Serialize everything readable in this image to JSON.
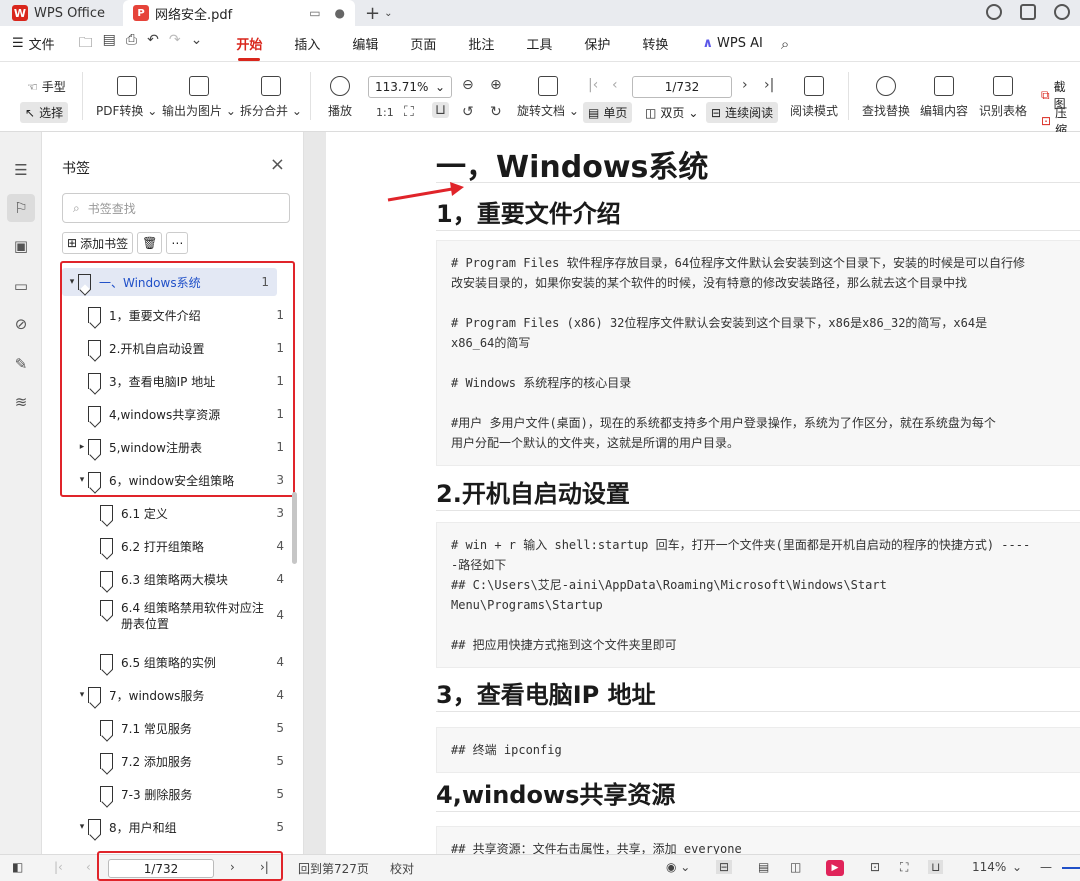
{
  "titlebar": {
    "app_name": "WPS Office",
    "tab_title": "网络安全.pdf"
  },
  "menubar": {
    "file_label": "文件",
    "tabs": [
      "开始",
      "插入",
      "编辑",
      "页面",
      "批注",
      "工具",
      "保护",
      "转换"
    ],
    "active_tab": "开始",
    "ai_label": "WPS AI"
  },
  "toolbar": {
    "hand_label": "手型",
    "select_label": "选择",
    "pdf_convert": "PDF转换",
    "export_image": "输出为图片",
    "split_merge": "拆分合并",
    "play": "播放",
    "zoom_value": "113.71%",
    "rotate": "旋转文档",
    "single_page": "单页",
    "double_page": "双页",
    "continuous": "连续阅读",
    "read_mode": "阅读模式",
    "page_value": "1/732",
    "find_replace": "查找替换",
    "edit_content": "编辑内容",
    "recognize_table": "识别表格",
    "screenshot": "截图",
    "compress": "压缩"
  },
  "bookmarks": {
    "title": "书签",
    "search_placeholder": "书签查找",
    "add_label": "添加书签",
    "items": [
      {
        "label": "一、Windows系统",
        "page": "1",
        "level": 0,
        "caret": "▾"
      },
      {
        "label": "1，重要文件介绍",
        "page": "1",
        "level": 1,
        "caret": ""
      },
      {
        "label": "2.开机自启动设置",
        "page": "1",
        "level": 1,
        "caret": ""
      },
      {
        "label": "3，查看电脑IP 地址",
        "page": "1",
        "level": 1,
        "caret": ""
      },
      {
        "label": "4,windows共享资源",
        "page": "1",
        "level": 1,
        "caret": ""
      },
      {
        "label": "5,window注册表",
        "page": "1",
        "level": 1,
        "caret": "▸"
      },
      {
        "label": "6，window安全组策略",
        "page": "3",
        "level": 1,
        "caret": "▾"
      },
      {
        "label": "6.1 定义",
        "page": "3",
        "level": 2,
        "caret": ""
      },
      {
        "label": "6.2 打开组策略",
        "page": "4",
        "level": 2,
        "caret": ""
      },
      {
        "label": "6.3 组策略两大模块",
        "page": "4",
        "level": 2,
        "caret": ""
      },
      {
        "label": "6.4 组策略禁用软件对应注",
        "label2": "册表位置",
        "page": "4",
        "level": 2,
        "caret": ""
      },
      {
        "label": "6.5 组策略的实例",
        "page": "4",
        "level": 2,
        "caret": ""
      },
      {
        "label": "7，windows服务",
        "page": "4",
        "level": 1,
        "caret": "▾"
      },
      {
        "label": "7.1 常见服务",
        "page": "5",
        "level": 2,
        "caret": ""
      },
      {
        "label": "7.2 添加服务",
        "page": "5",
        "level": 2,
        "caret": ""
      },
      {
        "label": "7-3 删除服务",
        "page": "5",
        "level": 2,
        "caret": ""
      },
      {
        "label": "8，用户和组",
        "page": "5",
        "level": 1,
        "caret": "▾"
      }
    ]
  },
  "document": {
    "h1": "一，Windows系统",
    "sections": [
      {
        "heading": "1，重要文件介绍",
        "lines": [
          "# Program Files 软件程序存放目录，64位程序文件默认会安装到这个目录下，安装的时候是可以自行修",
          "改安装目录的，如果你安装的某个软件的时候，没有特意的修改安装路径，那么就去这个目录中找",
          "",
          "# Program Files (x86)   32位程序文件默认会安装到这个目录下，x86是x86_32的简写，x64是",
          "x86_64的简写",
          "",
          "# Windows   系统程序的核心目录",
          "",
          "#用户      多用户文件(桌面)，现在的系统都支持多个用户登录操作，系统为了作区分，就在系统盘为每个",
          "用户分配一个默认的文件夹，这就是所谓的用户目录。"
        ]
      },
      {
        "heading": "2.开机自启动设置",
        "lines": [
          "# win + r 输入 shell:startup 回车，打开一个文件夹(里面都是开机自启动的程序的快捷方式) ----",
          "-路径如下",
          "## C:\\Users\\艾尼-aini\\AppData\\Roaming\\Microsoft\\Windows\\Start",
          "Menu\\Programs\\Startup",
          "",
          "## 把应用快捷方式拖到这个文件夹里即可"
        ]
      },
      {
        "heading": "3，查看电脑IP 地址",
        "lines": [
          "## 终端  ipconfig"
        ]
      },
      {
        "heading": "4,windows共享资源",
        "lines": [
          "## 共享资源：文件右击属性，共享，添加 everyone"
        ]
      }
    ]
  },
  "statusbar": {
    "page_value": "1/732",
    "goto_label": "回到第727页",
    "proofread": "校对",
    "zoom": "114%"
  },
  "colors": {
    "accent": "#d9261c",
    "annotation_red": "#e0242a",
    "selected_blue": "#2050c8"
  }
}
